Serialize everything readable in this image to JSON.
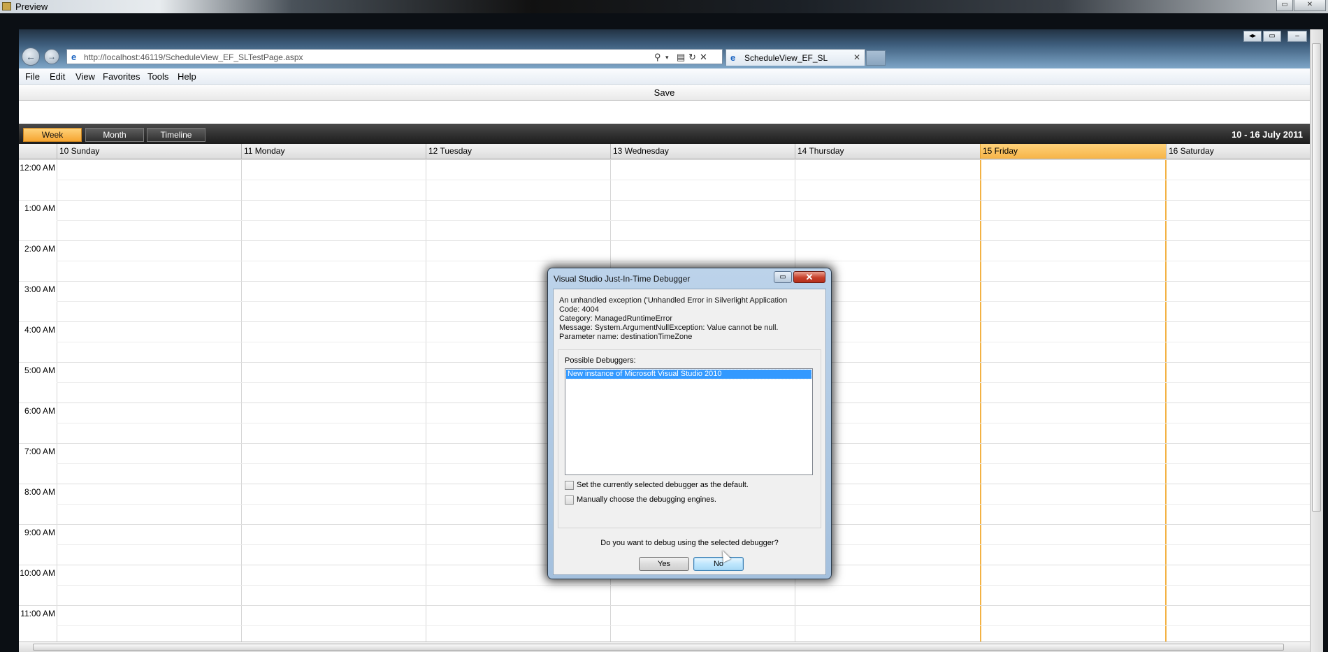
{
  "preview": {
    "title": "Preview"
  },
  "browser": {
    "url": "http://localhost:46119/ScheduleView_EF_SLTestPage.aspx",
    "tab_title": "ScheduleView_EF_SL",
    "menu": [
      "File",
      "Edit",
      "View",
      "Favorites",
      "Tools",
      "Help"
    ]
  },
  "app": {
    "save_label": "Save",
    "views": [
      "Week",
      "Month",
      "Timeline"
    ],
    "active_view": "Week",
    "date_range": "10  - 16 July 2011",
    "days": [
      "10 Sunday",
      "11 Monday",
      "12 Tuesday",
      "13 Wednesday",
      "14 Thursday",
      "15 Friday",
      "16 Saturday"
    ],
    "today": "15 Friday",
    "times": [
      "12:00 AM",
      "1:00 AM",
      "2:00 AM",
      "3:00 AM",
      "4:00 AM",
      "5:00 AM",
      "6:00 AM",
      "7:00 AM",
      "8:00 AM",
      "9:00 AM",
      "10:00 AM",
      "11:00 AM"
    ]
  },
  "dialog": {
    "title": "Visual Studio Just-In-Time Debugger",
    "message_lines": [
      "An unhandled exception ('Unhandled Error in Silverlight Application",
      "Code: 4004",
      "Category: ManagedRuntimeError",
      "Message: System.ArgumentNullException: Value cannot be null.",
      "Parameter name: destinationTimeZone"
    ],
    "debuggers_label": "Possible Debuggers:",
    "debuggers": [
      "New instance of Microsoft Visual Studio 2010"
    ],
    "checkbox_default": "Set the currently selected debugger as the default.",
    "checkbox_manual": "Manually choose the debugging engines.",
    "question": "Do you want to debug using the selected debugger?",
    "yes_label": "Yes",
    "no_label": "No"
  },
  "colors": {
    "accent": "#f6a531",
    "today_line": "#f3b244",
    "selection": "#3399ff"
  },
  "icons": [
    "back-icon",
    "forward-icon",
    "ie-icon",
    "search-icon",
    "refresh-icon",
    "stop-icon",
    "close-icon"
  ]
}
